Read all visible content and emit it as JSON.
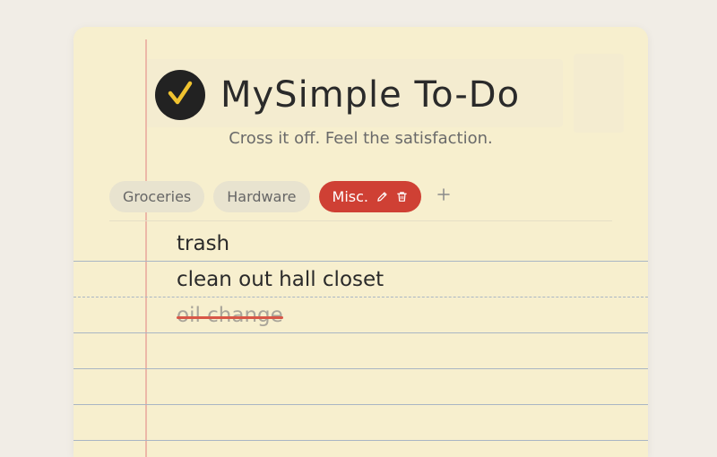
{
  "app": {
    "title": "MySimple To-Do",
    "subtitle": "Cross it off. Feel the satisfaction."
  },
  "lists": [
    {
      "label": "Groceries",
      "active": false
    },
    {
      "label": "Hardware",
      "active": false
    },
    {
      "label": "Misc.",
      "active": true
    }
  ],
  "tasks": [
    {
      "text": "trash",
      "completed": false
    },
    {
      "text": "clean out hall closet",
      "completed": false
    },
    {
      "text": "oil change",
      "completed": true
    }
  ],
  "icons": {
    "logo": "checkmark-icon",
    "edit": "pencil-icon",
    "delete": "trash-icon",
    "add": "plus-icon"
  },
  "colors": {
    "accent": "#cf4034",
    "logo_check": "#f0c330",
    "paper": "#f7efce",
    "strike": "#d85747"
  }
}
